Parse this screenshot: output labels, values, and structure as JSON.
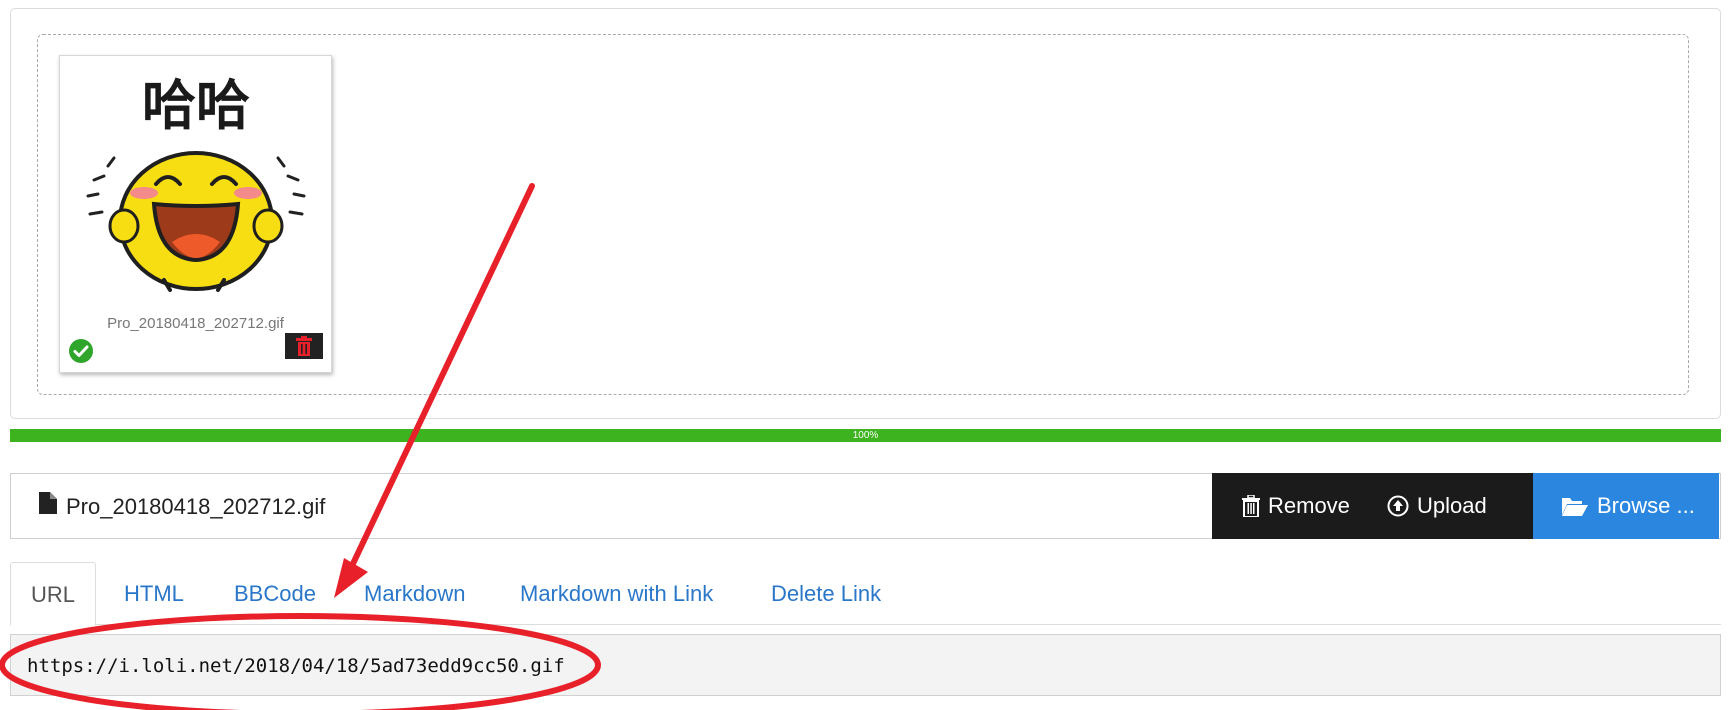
{
  "upload": {
    "file_name": "Pro_20180418_202712.gif",
    "thumbnail_caption": "哈哈",
    "progress_percent": 100,
    "progress_label": "100%"
  },
  "actions": {
    "remove_label": "Remove",
    "upload_label": "Upload",
    "browse_label": "Browse ..."
  },
  "tabs": [
    {
      "label": "URL",
      "active": true
    },
    {
      "label": "HTML",
      "active": false
    },
    {
      "label": "BBCode",
      "active": false
    },
    {
      "label": "Markdown",
      "active": false
    },
    {
      "label": "Markdown with Link",
      "active": false
    },
    {
      "label": "Delete Link",
      "active": false
    }
  ],
  "result": {
    "url": "https://i.loli.net/2018/04/18/5ad73edd9cc50.gif"
  },
  "colors": {
    "progress": "#3eb320",
    "browse": "#2b86e0",
    "dark_button": "#1b1b1b",
    "link": "#2a77c9",
    "annotation": "#e8202a"
  }
}
